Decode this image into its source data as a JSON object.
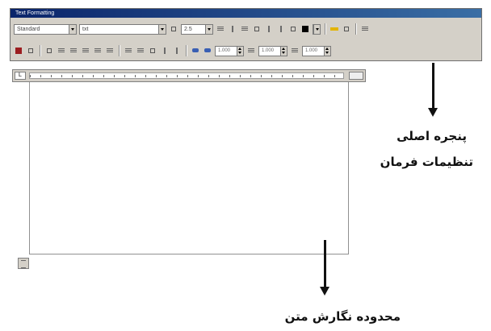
{
  "toolbar": {
    "title": "Text Formatting",
    "style_value": "Standard",
    "font_value": "txt",
    "size_value": "2.5",
    "spin_values": [
      "1.000",
      "1.000",
      "1.000"
    ]
  },
  "editor": {
    "ruler_corner": "L"
  },
  "annotations": {
    "toolbar_caption_line1": "پنجره اصلی",
    "toolbar_caption_line2": "تنظیمات فرمان",
    "editor_caption": "محدوده نگارش متن"
  },
  "colors": {
    "toolbar_bg": "#d4d0c8",
    "title_bar": "#0a246a",
    "ink": "#111111"
  }
}
